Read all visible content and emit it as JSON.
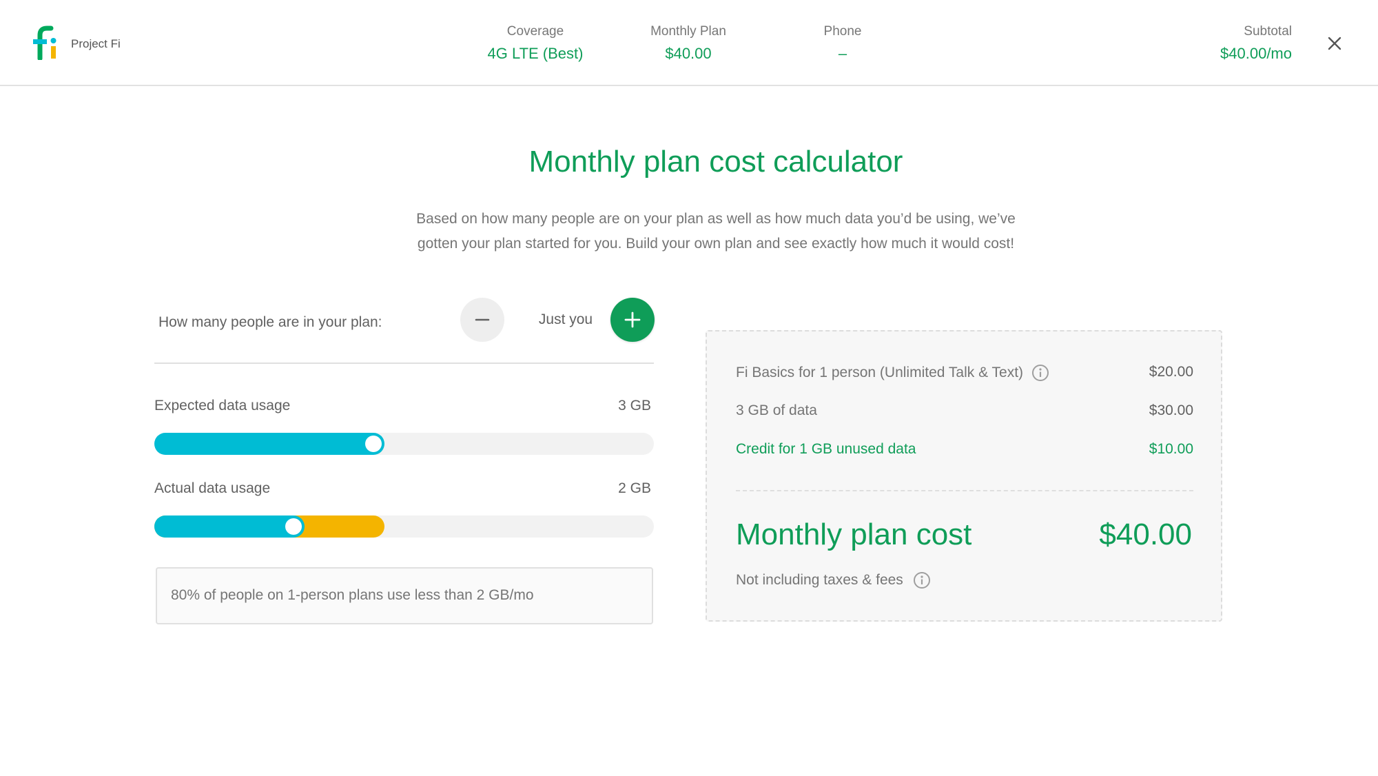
{
  "header": {
    "brand": "Project Fi",
    "coverage": {
      "label": "Coverage",
      "value": "4G LTE (Best)"
    },
    "monthly_plan": {
      "label": "Monthly Plan",
      "value": "$40.00"
    },
    "phone": {
      "label": "Phone",
      "value": "–"
    },
    "subtotal": {
      "label": "Subtotal",
      "value": "$40.00/mo"
    },
    "close_icon": "close-icon"
  },
  "page": {
    "title": "Monthly plan cost calculator",
    "intro_line1": "Based on how many people are on your plan as well as how much data you’d be using, we’ve",
    "intro_line2": "gotten your plan started for you. Build your own plan and see exactly how much it would cost!"
  },
  "people": {
    "label": "How many people are in your plan:",
    "value": "Just you",
    "minus_icon": "minus-icon",
    "plus_icon": "plus-icon"
  },
  "expected_usage": {
    "label": "Expected data usage",
    "value": "3 GB",
    "fill_fraction": 0.46,
    "color": "#00bcd4"
  },
  "actual_usage": {
    "label": "Actual data usage",
    "value": "2 GB",
    "fill_fraction": 0.3,
    "unused_fraction": 0.46,
    "color": "#00bcd4",
    "unused_color": "#f4b400"
  },
  "hint": "80% of people on 1-person plans use less than  2 GB/mo",
  "summary": {
    "items": [
      {
        "label": "Fi Basics for 1 person (Unlimited Talk & Text)",
        "amount": "$20.00",
        "info": true
      },
      {
        "label": "3 GB of data",
        "amount": "$30.00"
      },
      {
        "label": "Credit for 1 GB unused data",
        "amount": "$10.00",
        "credit": true
      }
    ],
    "total_label": "Monthly plan cost",
    "total_amount": "$40.00",
    "fees_note": "Not including taxes & fees"
  },
  "colors": {
    "accent_green": "#0f9d58",
    "data_blue": "#00bcd4",
    "unused_yellow": "#f4b400"
  }
}
